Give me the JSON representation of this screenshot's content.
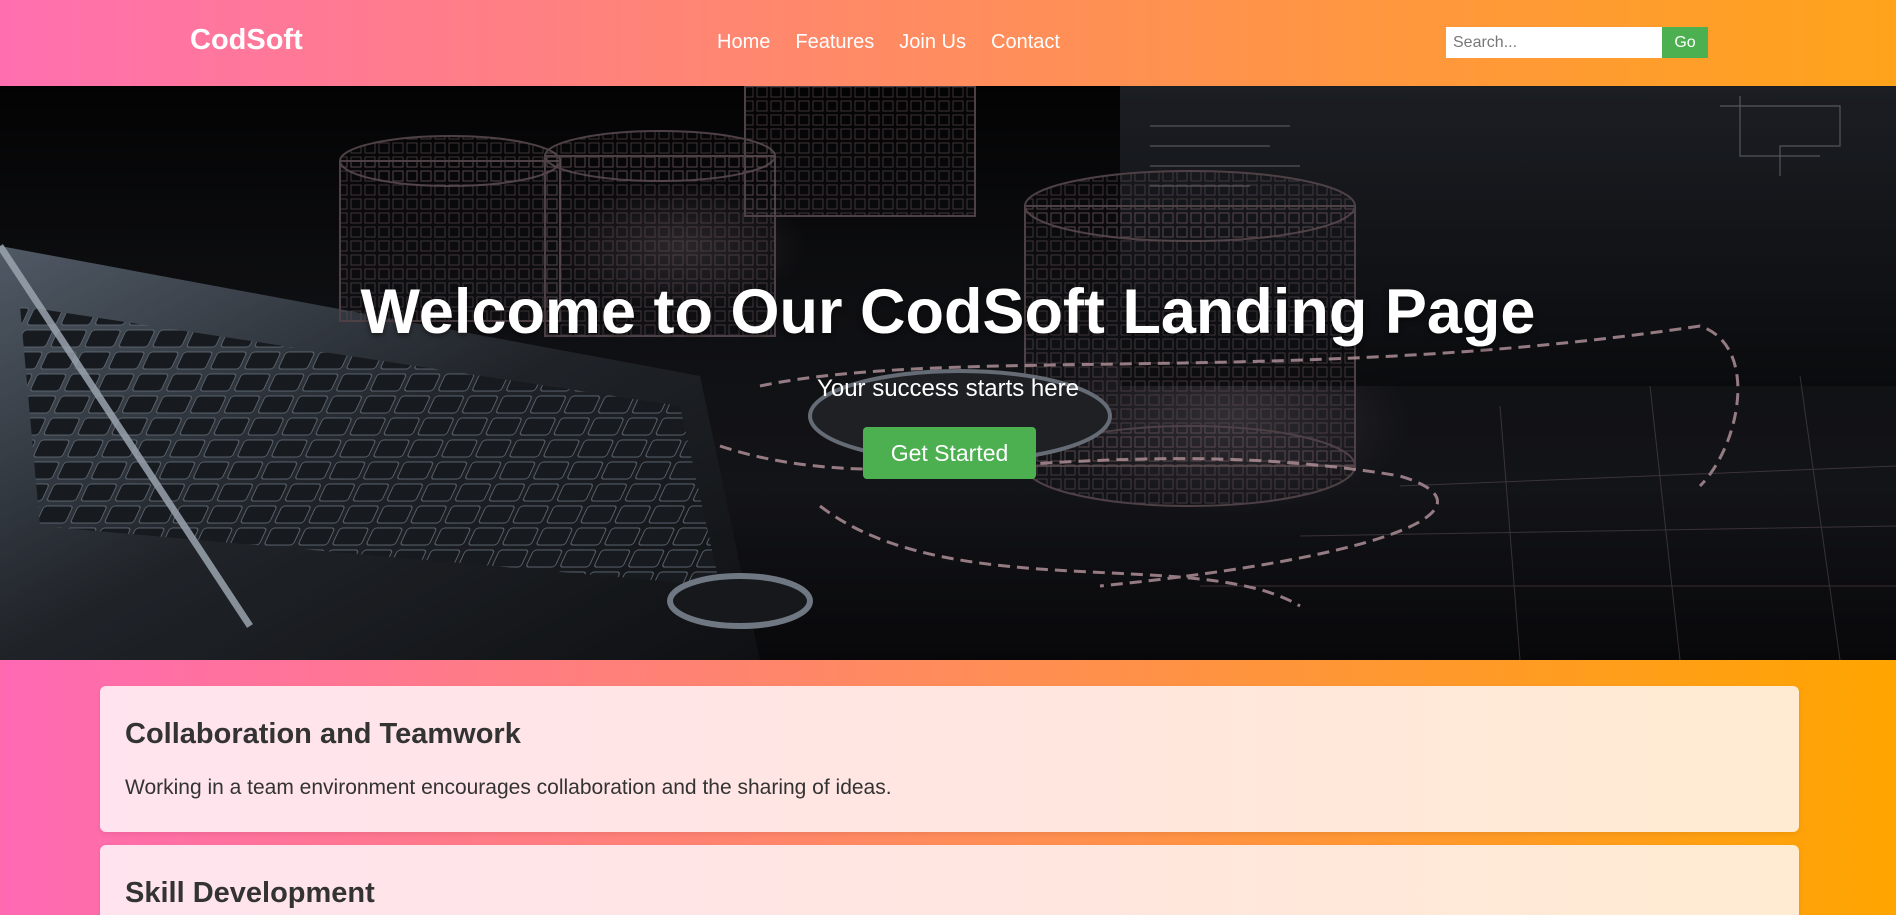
{
  "header": {
    "brand": "CodSoft",
    "nav": [
      "Home",
      "Features",
      "Join Us",
      "Contact"
    ],
    "search": {
      "placeholder": "Search...",
      "value": "",
      "button_label": "Go"
    }
  },
  "hero": {
    "title": "Welcome to Our CodSoft Landing Page",
    "subtitle": "Your success starts here",
    "cta_label": "Get Started"
  },
  "cards": [
    {
      "title": "Collaboration and Teamwork",
      "text": "Working in a team environment encourages collaboration and the sharing of ideas."
    },
    {
      "title": "Skill Development",
      "text": ""
    }
  ],
  "colors": {
    "accent_green": "#4caf50",
    "gradient_start": "#ff69b4",
    "gradient_end": "#ffa500",
    "text_dark": "#333333"
  }
}
